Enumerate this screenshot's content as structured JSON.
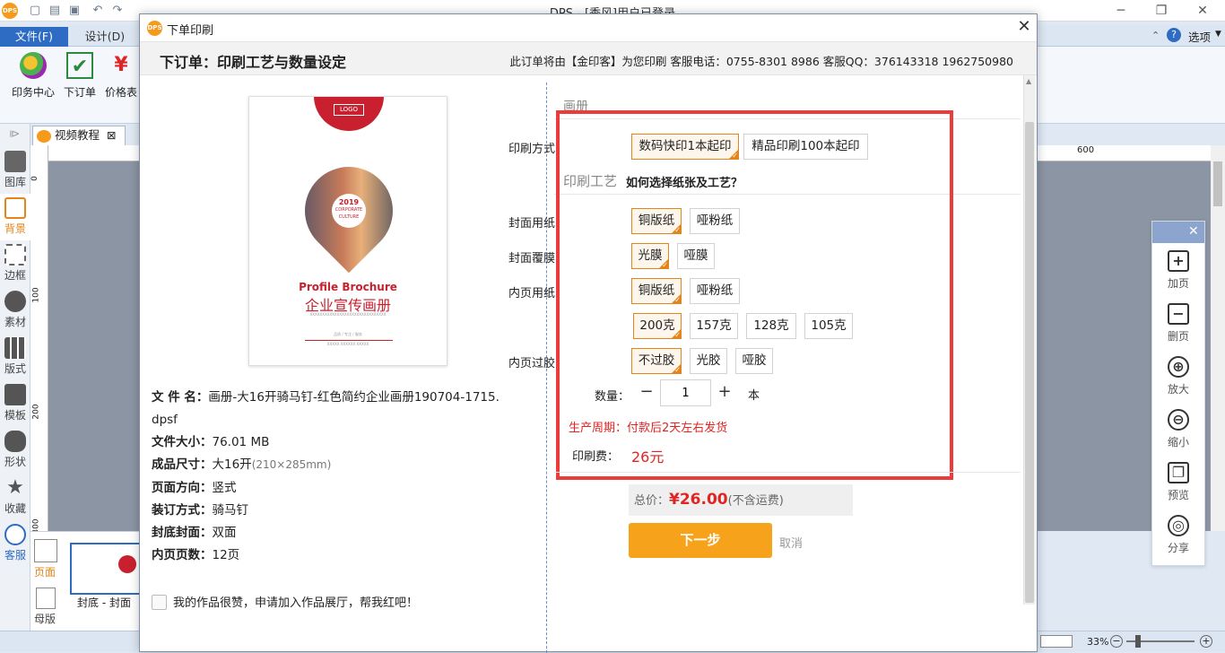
{
  "app": {
    "title": "DPS - [季风]用户已登录",
    "options_label": "选项",
    "help_label": "?"
  },
  "ribbon": {
    "tabs": [
      {
        "label": "文件(F)"
      },
      {
        "label": "设计(D)"
      }
    ],
    "buttons": [
      {
        "label": "印务中心",
        "icon": "print-center-icon"
      },
      {
        "label": "下订单",
        "icon": "order-check-icon"
      },
      {
        "label": "价格表",
        "icon": "price-yen-icon"
      }
    ]
  },
  "doc_tab": {
    "label": "视频教程",
    "close": "⊠"
  },
  "left_sidebar": {
    "items": [
      {
        "label": "图库"
      },
      {
        "label": "背景"
      },
      {
        "label": "边框"
      },
      {
        "label": "素材"
      },
      {
        "label": "版式"
      },
      {
        "label": "模板"
      },
      {
        "label": "形状"
      },
      {
        "label": "收藏"
      },
      {
        "label": "客服"
      }
    ]
  },
  "rulers": {
    "v_ticks": [
      "0",
      "100",
      "200",
      "300"
    ],
    "h_tick": "600"
  },
  "page_strip": {
    "page_label": "页面",
    "master_label": "母版",
    "thumb_caption": "封底 - 封面"
  },
  "float_panel": {
    "items": [
      {
        "label": "加页",
        "glyph": "+"
      },
      {
        "label": "删页",
        "glyph": "−"
      },
      {
        "label": "放大",
        "glyph": "⊕"
      },
      {
        "label": "缩小",
        "glyph": "⊖"
      },
      {
        "label": "预览",
        "glyph": "❐"
      },
      {
        "label": "分享",
        "glyph": "◎"
      }
    ]
  },
  "statusbar": {
    "zoom": "33%"
  },
  "dialog": {
    "title": "下单印刷",
    "heading": "下订单：印刷工艺与数量设定",
    "service": "此订单将由【金印客】为您印刷 客服电话：0755-8301 8986 客服QQ：376143318 1962750980",
    "cover": {
      "logo": "LOGO",
      "year": "2019",
      "badge_sub": "CORPORATE CULTURE",
      "title_en": "Profile Brochure",
      "title_cn": "企业宣传画册",
      "tiny": "XXXXXXXXXXXXXXXXXXXXXXXXXXXXXXX",
      "bottom1": "品质 / 专注 / 服务",
      "bottom2": "XXXXX XXXXXX XXXXX"
    },
    "file_info": [
      {
        "label": "文  件  名：",
        "value": "画册-大16开骑马钉-红色简约企业画册190704-1715.",
        "value2": "dpsf"
      },
      {
        "label": "文件大小：",
        "value": "76.01 MB"
      },
      {
        "label": "成品尺寸：",
        "value": "大16开",
        "note": "(210×285mm)"
      },
      {
        "label": "页面方向：",
        "value": "竖式"
      },
      {
        "label": "装订方式：",
        "value": "骑马钉"
      },
      {
        "label": "封底封面：",
        "value": "双面"
      },
      {
        "label": "内页页数：",
        "value": "12页"
      }
    ],
    "agree_text": "我的作品很赞，申请加入作品展厅，帮我红吧！",
    "section_album": "画册",
    "section_craft": "印刷工艺",
    "craft_link": "如何选择纸张及工艺？",
    "print_method": {
      "label": "印刷方式：",
      "options": [
        {
          "label": "数码快印1本起印",
          "selected": true
        },
        {
          "label": "精品印刷100本起印",
          "selected": false
        }
      ]
    },
    "cover_paper": {
      "label": "封面用纸：",
      "options": [
        {
          "label": "铜版纸",
          "selected": true
        },
        {
          "label": "哑粉纸",
          "selected": false
        }
      ]
    },
    "cover_film": {
      "label": "封面覆膜：",
      "options": [
        {
          "label": "光膜",
          "selected": true
        },
        {
          "label": "哑膜",
          "selected": false
        }
      ]
    },
    "inner_paper": {
      "label": "内页用纸：",
      "options": [
        {
          "label": "铜版纸",
          "selected": true
        },
        {
          "label": "哑粉纸",
          "selected": false
        }
      ],
      "weights": [
        {
          "label": "200克",
          "selected": true
        },
        {
          "label": "157克",
          "selected": false
        },
        {
          "label": "128克",
          "selected": false
        },
        {
          "label": "105克",
          "selected": false
        }
      ]
    },
    "inner_glue": {
      "label": "内页过胶：",
      "options": [
        {
          "label": "不过胶",
          "selected": true
        },
        {
          "label": "光胶",
          "selected": false
        },
        {
          "label": "哑胶",
          "selected": false
        }
      ]
    },
    "quantity": {
      "label": "数量：",
      "minus": "−",
      "value": "1",
      "plus": "+",
      "unit": "本"
    },
    "cycle": "生产周期：付款后2天左右发货",
    "fee": {
      "label": "印刷费：",
      "value": "26元"
    },
    "total": {
      "label": "总价：",
      "value": "¥26.00",
      "note": "(不含运费)"
    },
    "next_label": "下一步",
    "cancel_label": "取消",
    "close": "✕",
    "colors": {
      "accent": "#f7a21b",
      "selected_border": "#e2851a",
      "price": "#e02424",
      "highlight_box": "#ec3b3b"
    }
  }
}
